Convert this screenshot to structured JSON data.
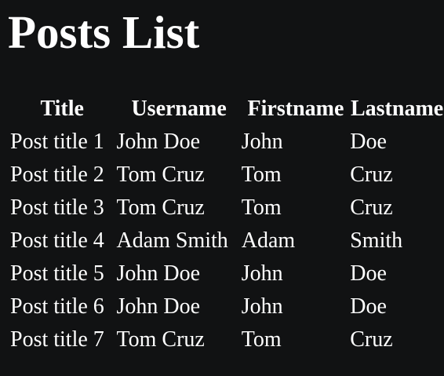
{
  "page": {
    "title": "Posts List"
  },
  "table": {
    "headers": [
      "Title",
      "Username",
      "Firstname",
      "Lastname"
    ],
    "rows": [
      [
        "Post title 1",
        "John Doe",
        "John",
        "Doe"
      ],
      [
        "Post title 2",
        "Tom Cruz",
        "Tom",
        "Cruz"
      ],
      [
        "Post title 3",
        "Tom Cruz",
        "Tom",
        "Cruz"
      ],
      [
        "Post title 4",
        "Adam Smith",
        "Adam",
        "Smith"
      ],
      [
        "Post title 5",
        "John Doe",
        "John",
        "Doe"
      ],
      [
        "Post title 6",
        "John Doe",
        "John",
        "Doe"
      ],
      [
        "Post title 7",
        "Tom Cruz",
        "Tom",
        "Cruz"
      ]
    ]
  },
  "colors": {
    "background": "#111213",
    "text": "#ffffff"
  }
}
